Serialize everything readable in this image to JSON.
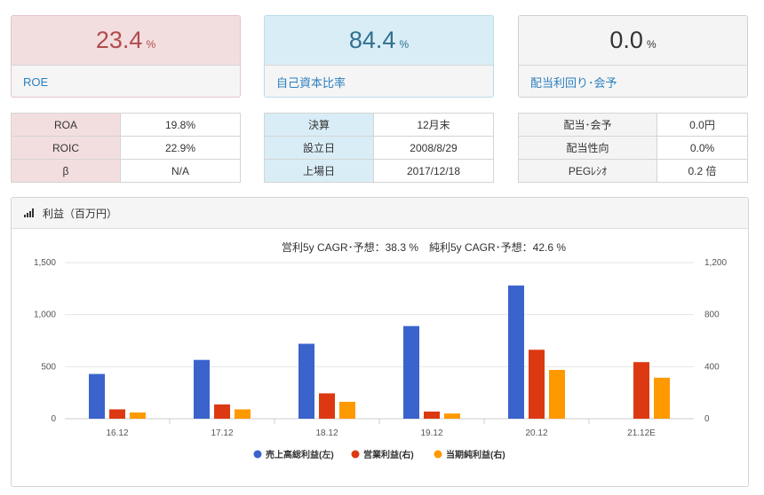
{
  "cards": [
    {
      "value": "23.4",
      "unit": "%",
      "label": "ROE"
    },
    {
      "value": "84.4",
      "unit": "%",
      "label": "自己資本比率"
    },
    {
      "value": "0.0",
      "unit": "%",
      "label": "配当利回り･会予"
    }
  ],
  "tables": [
    [
      {
        "k": "ROA",
        "v": "19.8%"
      },
      {
        "k": "ROIC",
        "v": "22.9%"
      },
      {
        "k": "β",
        "v": "N/A"
      }
    ],
    [
      {
        "k": "決算",
        "v": "12月末"
      },
      {
        "k": "設立日",
        "v": "2008/8/29"
      },
      {
        "k": "上場日",
        "v": "2017/12/18"
      }
    ],
    [
      {
        "k": "配当･会予",
        "v": "0.0円"
      },
      {
        "k": "配当性向",
        "v": "0.0%"
      },
      {
        "k": "PEGﾚｼｵ",
        "v": "0.2 倍"
      }
    ]
  ],
  "panel": {
    "title": "利益（百万円）",
    "icon": "bar-chart-icon"
  },
  "colors": {
    "series1": "#3a63cc",
    "series2": "#dc3912",
    "series3": "#ff9900",
    "grid": "#e6e6e6",
    "axis": "#cccccc"
  },
  "chart_data": {
    "type": "bar",
    "title": "営利5y CAGR･予想：38.3 %　純利5y CAGR･予想：42.6 %",
    "categories": [
      "16.12",
      "17.12",
      "18.12",
      "19.12",
      "20.12",
      "21.12E"
    ],
    "y_left": {
      "min": 0,
      "max": 1500,
      "ticks": [
        "0",
        "500",
        "1,000",
        "1,500"
      ],
      "tick_values": [
        0,
        500,
        1000,
        1500
      ]
    },
    "y_right": {
      "min": 0,
      "max": 1200,
      "ticks": [
        "0",
        "400",
        "800",
        "1,200"
      ],
      "tick_values": [
        0,
        400,
        800,
        1200
      ]
    },
    "grid": true,
    "legend_position": "bottom",
    "series": [
      {
        "name": "売上高総利益(左)",
        "axis": "left",
        "values": [
          430,
          565,
          720,
          890,
          1280,
          null
        ]
      },
      {
        "name": "営業利益(右)",
        "axis": "right",
        "values": [
          72,
          110,
          195,
          55,
          530,
          435
        ]
      },
      {
        "name": "当期純利益(右)",
        "axis": "right",
        "values": [
          48,
          72,
          130,
          40,
          375,
          315
        ]
      }
    ]
  }
}
